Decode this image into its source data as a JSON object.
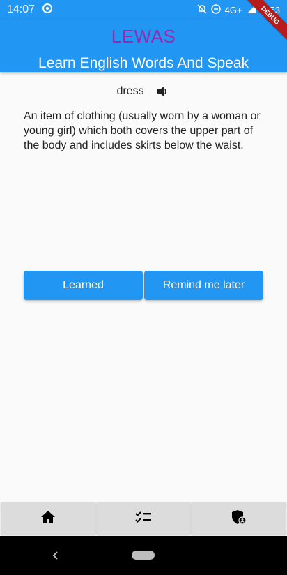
{
  "status_bar": {
    "time": "14:07",
    "network": "4G+",
    "battery": "53"
  },
  "app_bar": {
    "title": "LEWAS",
    "subtitle": "Learn English Words And Speak",
    "title_color": "#9c27b0",
    "background_color": "#2196f3",
    "debug_label": "DEBUG"
  },
  "word_card": {
    "word": "dress",
    "definition": "An item of clothing (usually worn by a woman or young girl) which both covers the upper part of the body and includes skirts below the waist."
  },
  "actions": {
    "learned_label": "Learned",
    "remind_label": "Remind me later"
  },
  "bottom_nav": {
    "items": [
      {
        "icon": "home-icon"
      },
      {
        "icon": "checklist-icon"
      },
      {
        "icon": "shield-account-icon"
      }
    ]
  },
  "icons": {
    "speaker": "volume-icon",
    "back": "back-chevron-icon"
  }
}
